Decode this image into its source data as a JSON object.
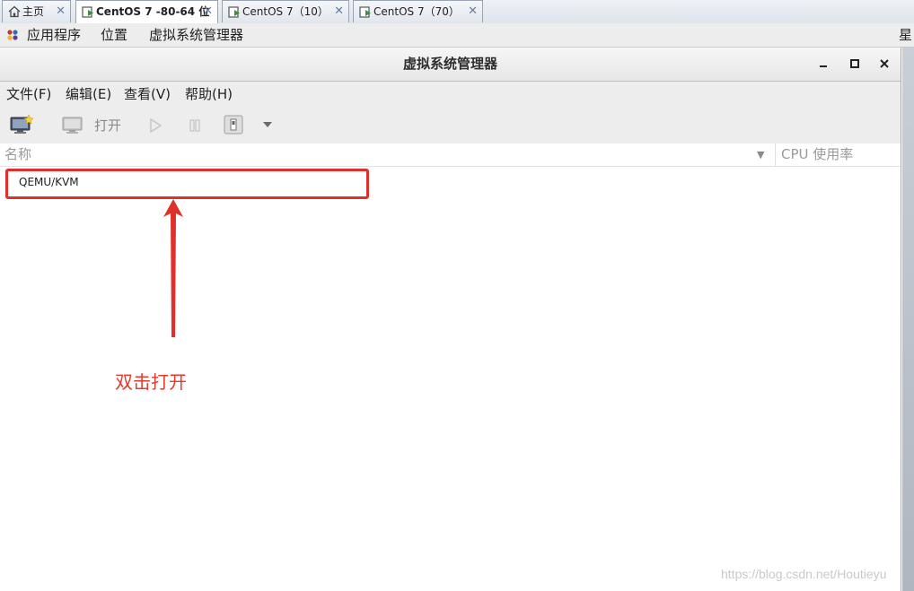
{
  "host_tabs": [
    {
      "label": "主页",
      "icon": "home-icon",
      "active": false
    },
    {
      "label": "CentOS 7 -80-64 位",
      "icon": "vm-icon",
      "active": true
    },
    {
      "label": "CentOS 7（10）",
      "icon": "vm-icon",
      "active": false
    },
    {
      "label": "CentOS 7（70）",
      "icon": "vm-icon",
      "active": false
    }
  ],
  "gnome_panel": {
    "applications": "应用程序",
    "places": "位置",
    "active_app": "虚拟系统管理器",
    "clock_fragment": "星"
  },
  "window": {
    "title": "虚拟系统管理器"
  },
  "menu": {
    "file": "文件(F)",
    "edit": "编辑(E)",
    "view": "查看(V)",
    "help": "帮助(H)"
  },
  "toolbar": {
    "open_label": "打开"
  },
  "columns": {
    "name": "名称",
    "cpu": "CPU 使用率"
  },
  "connections": [
    {
      "label": "QEMU/KVM"
    }
  ],
  "annotation": {
    "note": "双击打开",
    "color": "#e53a2c"
  },
  "watermark": "https://blog.csdn.net/Houtieyu"
}
